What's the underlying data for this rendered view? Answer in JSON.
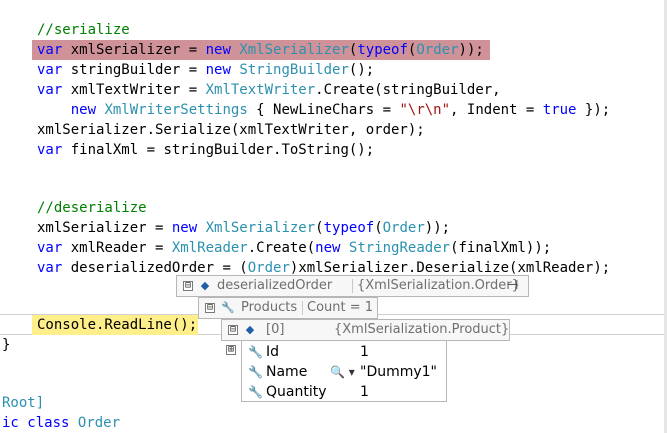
{
  "code": {
    "line_serialize_comment": "//serialize",
    "line1": {
      "kw1": "var",
      "t1": " xmlSerializer = ",
      "kw2": "new",
      "t2": " ",
      "ty1": "XmlSerializer",
      "t3": "(",
      "kw3": "typeof",
      "t4": "(",
      "ty2": "Order",
      "t5": "));"
    },
    "line2": {
      "kw1": "var",
      "t1": " stringBuilder = ",
      "kw2": "new",
      "t2": " ",
      "ty1": "StringBuilder",
      "t3": "();"
    },
    "line3": {
      "kw1": "var",
      "t1": " xmlTextWriter = ",
      "ty1": "XmlTextWriter",
      "t2": ".Create(stringBuilder,"
    },
    "line4": {
      "indent": "    ",
      "kw1": "new",
      "t1": " ",
      "ty1": "XmlWriterSettings",
      "t2": " { NewLineChars = ",
      "st1": "\"\\r\\n\"",
      "t3": ", Indent = ",
      "kw2": "true",
      "t4": " });"
    },
    "line5": "xmlSerializer.Serialize(xmlTextWriter, order);",
    "line6": {
      "kw1": "var",
      "t1": " finalXml = stringBuilder.ToString();"
    },
    "line_deserialize_comment": "//deserialize",
    "line7": {
      "t0": "xmlSerializer = ",
      "kw1": "new",
      "t1": " ",
      "ty1": "XmlSerializer",
      "t2": "(",
      "kw2": "typeof",
      "t3": "(",
      "ty2": "Order",
      "t4": "));"
    },
    "line8": {
      "kw1": "var",
      "t1": " xmlReader = ",
      "ty1": "XmlReader",
      "t2": ".Create(",
      "kw2": "new",
      "t3": " ",
      "ty2": "StringReader",
      "t4": "(finalXml));"
    },
    "line9": {
      "kw1": "var",
      "t1": " deserializedOrder = (",
      "ty1": "Order",
      "t2": ")xmlSerializer.Deserialize(xmlReader);"
    },
    "line10": "Console.ReadLine();",
    "line11": "}",
    "line12": {
      "t0": "Root]"
    },
    "line13": {
      "kw1": "ic",
      "t1": " ",
      "kw2": "class",
      "t2": " ",
      "ty1": "Order"
    }
  },
  "datatips": {
    "order": {
      "expander": "⊟",
      "name": "deserializedOrder",
      "value": "{XmlSerialization.Order}",
      "pin": "⊣"
    },
    "products": {
      "expander": "⊟",
      "name": "Products",
      "value": "Count = 1"
    },
    "item0": {
      "expander": "⊟",
      "name": "[0]",
      "value": "{XmlSerialization.Product}"
    },
    "props_expander": "⊞",
    "props": [
      {
        "name": "Id",
        "value": "1"
      },
      {
        "name": "Name",
        "value": "\"Dummy1\"",
        "visualizer": "🔍 ▾"
      },
      {
        "name": "Quantity",
        "value": "1"
      }
    ]
  },
  "colors": {
    "keyword": "#0000ff",
    "type": "#2b91af",
    "comment": "#008000",
    "string": "#a31515",
    "breakpoint_line": "#b04a55",
    "current_line": "#ffef8a"
  }
}
